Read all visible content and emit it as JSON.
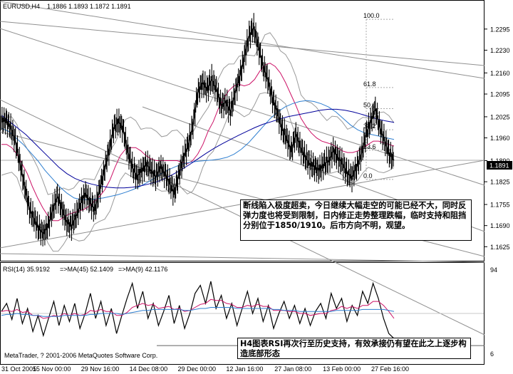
{
  "chart_data": [
    {
      "type": "line",
      "title": "EURUSD,H4  1.1886 1.1893 1.1872 1.1891",
      "symbol_label": "EURUSD,H4",
      "ohlc_label": "1.1886 1.1893 1.1872 1.1891",
      "x": [
        "31 Oct 2005",
        "15 Nov 00:00",
        "29 Nov 16:00",
        "14 Dec 08:00",
        "29 Dec 00:00",
        "12 Jan 16:00",
        "27 Jan 08:00",
        "13 Feb 00:00",
        "27 Feb 16:00"
      ],
      "ylim": [
        1.1595,
        1.2345
      ],
      "yticks": [
        "1.2295",
        "1.2230",
        "1.2160",
        "1.2095",
        "1.2025",
        "1.1960",
        "1.1890",
        "1.1825",
        "1.1755",
        "1.1690",
        "1.1625"
      ],
      "current_price": "1.1891",
      "fib_levels": [
        {
          "label": "100.0",
          "value": 1.2325
        },
        {
          "label": "61.8",
          "value": 1.2115
        },
        {
          "label": "50.0",
          "value": 1.205
        },
        {
          "label": "38.2",
          "value": 1.1985
        },
        {
          "label": "23.6",
          "value": 1.1922
        },
        {
          "label": "0.0",
          "value": 1.1832
        }
      ],
      "series": [
        {
          "key": "price",
          "color": "#000000",
          "values": [
            1.201,
            1.2015,
            1.199,
            1.195,
            1.188,
            1.181,
            1.174,
            1.171,
            1.168,
            1.1665,
            1.169,
            1.174,
            1.178,
            1.174,
            1.17,
            1.169,
            1.172,
            1.176,
            1.179,
            1.176,
            1.174,
            1.18,
            1.186,
            1.192,
            1.199,
            1.201,
            1.199,
            1.192,
            1.187,
            1.184,
            1.186,
            1.188,
            1.186,
            1.184,
            1.187,
            1.185,
            1.182,
            1.179,
            1.185,
            1.19,
            1.194,
            1.2,
            1.21,
            1.213,
            1.211,
            1.214,
            1.211,
            1.206,
            1.207,
            1.204,
            1.21,
            1.215,
            1.221,
            1.2275,
            1.23,
            1.224,
            1.218,
            1.214,
            1.208,
            1.204,
            1.199,
            1.196,
            1.192,
            1.197,
            1.193,
            1.19,
            1.188,
            1.187,
            1.186,
            1.188,
            1.189,
            1.192,
            1.19,
            1.188,
            1.185,
            1.184,
            1.187,
            1.191,
            1.197,
            1.201,
            1.205,
            1.199,
            1.195,
            1.191,
            1.1891
          ]
        },
        {
          "key": "ma-fast",
          "color": "#cc1166",
          "values": [
            1.194,
            1.194,
            1.193,
            1.191,
            1.188,
            1.185,
            1.181,
            1.1775,
            1.1745,
            1.172,
            1.1705,
            1.1705,
            1.1715,
            1.1725,
            1.173,
            1.1735,
            1.174,
            1.175,
            1.1765,
            1.178,
            1.18,
            1.183,
            1.187,
            1.1905,
            1.1925,
            1.193,
            1.193,
            1.192,
            1.1905,
            1.1895,
            1.189,
            1.189,
            1.189,
            1.189,
            1.189,
            1.1885,
            1.188,
            1.189,
            1.191,
            1.194,
            1.198,
            1.201,
            1.205,
            1.208,
            1.2105,
            1.212,
            1.2125,
            1.212,
            1.2125,
            1.214,
            1.2165,
            1.2185,
            1.219,
            1.218,
            1.216,
            1.213,
            1.2095,
            1.206,
            1.202,
            1.1995,
            1.1975,
            1.196,
            1.195,
            1.1945,
            1.194,
            1.193,
            1.192,
            1.1915,
            1.1915,
            1.192,
            1.193,
            1.194,
            1.195,
            1.195,
            1.1945,
            1.194,
            1.1935
          ]
        },
        {
          "key": "ma-mid",
          "color": "#2f7fd0",
          "values": [
            1.199,
            1.198,
            1.196,
            1.194,
            1.1915,
            1.189,
            1.186,
            1.1835,
            1.181,
            1.179,
            1.1775,
            1.177,
            1.177,
            1.1772,
            1.1775,
            1.178,
            1.1785,
            1.1792,
            1.18,
            1.181,
            1.1822,
            1.1835,
            1.185,
            1.1862,
            1.1872,
            1.188,
            1.1885,
            1.1888,
            1.189,
            1.1892,
            1.1895,
            1.19,
            1.191,
            1.1925,
            1.1945,
            1.197,
            1.1995,
            1.202,
            1.204,
            1.2055,
            1.2065,
            1.2072,
            1.2075,
            1.2072,
            1.2065,
            1.2055,
            1.204,
            1.202,
            1.2,
            1.1985,
            1.1975,
            1.197,
            1.1965,
            1.196,
            1.1955
          ]
        },
        {
          "key": "ma-slow",
          "color": "#00009a",
          "values": [
            1.203,
            1.201,
            1.199,
            1.197,
            1.1945,
            1.192,
            1.1895,
            1.187,
            1.185,
            1.1835,
            1.1825,
            1.1818,
            1.1812,
            1.1808,
            1.1806,
            1.1806,
            1.1808,
            1.1812,
            1.1818,
            1.1825,
            1.1835,
            1.1848,
            1.1862,
            1.1878,
            1.1895,
            1.1912,
            1.1928,
            1.1942,
            1.1955,
            1.1968,
            1.198,
            1.1992,
            1.2002,
            1.201,
            1.2018,
            1.2025,
            1.203,
            1.2035,
            1.204,
            1.2045,
            1.2048,
            1.2048,
            1.2045,
            1.204,
            1.2033,
            1.2025,
            1.2018,
            1.2012,
            1.2008
          ]
        }
      ],
      "annotation": "断线陷入极度超卖，今日继续大幅走空的可能已经不大，同时反弹力度也将受到限制，日内修正走势整理跌幅，临时支持和阻挡分别位于1850/1910。后市方向不明，观望。"
    },
    {
      "type": "line",
      "title": "RSI(14) 35.9192 =>MA(45) 52.1409 =>MA(9) 42.1176",
      "rsi_label": "RSI(14) 35.9192",
      "ma45_label": "=>MA(45) 52.1409",
      "ma9_label": "=>MA(9) 42.1176",
      "ylim": [
        6,
        94
      ],
      "yticks": [
        "94",
        "6"
      ],
      "series": [
        {
          "key": "rsi",
          "color": "#000000",
          "values": [
            52,
            60,
            44,
            65,
            40,
            55,
            32,
            48,
            28,
            45,
            62,
            38,
            58,
            42,
            60,
            35,
            50,
            70,
            45,
            62,
            38,
            55,
            30,
            48,
            65,
            80,
            55,
            72,
            45,
            60,
            38,
            52,
            68,
            40,
            58,
            35,
            50,
            70,
            78,
            60,
            82,
            55,
            68,
            45,
            60,
            38,
            55,
            72,
            50,
            65,
            42,
            58,
            35,
            50,
            62,
            45,
            58,
            40,
            55,
            38,
            52,
            60,
            45,
            70,
            55,
            65,
            42,
            58,
            48,
            72,
            60,
            80,
            65,
            45,
            30,
            25
          ]
        },
        {
          "key": "rsi-ma9",
          "color": "#cc1166",
          "values": [
            52,
            53,
            52,
            54,
            51,
            52,
            48,
            48,
            45,
            46,
            48,
            47,
            50,
            48,
            50,
            48,
            49,
            53,
            52,
            54,
            52,
            52,
            48,
            48,
            51,
            56,
            58,
            60,
            58,
            59,
            55,
            56,
            57,
            54,
            55,
            52,
            53,
            56,
            59,
            60,
            64,
            63,
            63,
            60,
            59,
            56,
            56,
            58,
            57,
            59,
            57,
            57,
            53,
            53,
            53,
            52,
            52,
            50,
            50,
            48,
            49,
            50,
            50,
            53,
            54,
            57,
            55,
            57,
            55,
            58,
            58,
            62,
            62,
            58,
            52,
            45
          ]
        },
        {
          "key": "rsi-ma45",
          "color": "#2f7fd0",
          "values": [
            48,
            49,
            49,
            50,
            49,
            49,
            48,
            48,
            47,
            47,
            47,
            47,
            48,
            48,
            48,
            48,
            48,
            49,
            49,
            50,
            50,
            50,
            50,
            49,
            50,
            51,
            52,
            53,
            53,
            54,
            54,
            54,
            54,
            54,
            54,
            53,
            53,
            54,
            55,
            55,
            56,
            56,
            56,
            56,
            56,
            55,
            55,
            55,
            55,
            55,
            55,
            55,
            54,
            54,
            53,
            53,
            53,
            52,
            52,
            52,
            52,
            52,
            52,
            52,
            53,
            53,
            53,
            53,
            53,
            54,
            54,
            54,
            54,
            54,
            53,
            52
          ]
        }
      ],
      "annotation": "H4图表RSI再次行至历史支持，有效承接仍有望在此之上逐步构造底部形态"
    }
  ],
  "colors": {
    "background": "#ffffff",
    "grid": "#c0c0c0",
    "trendline": "#909090",
    "price": "#000000"
  },
  "watermark": "MetaTrader, ? 2001-2006 MetaQuotes Software Corp."
}
